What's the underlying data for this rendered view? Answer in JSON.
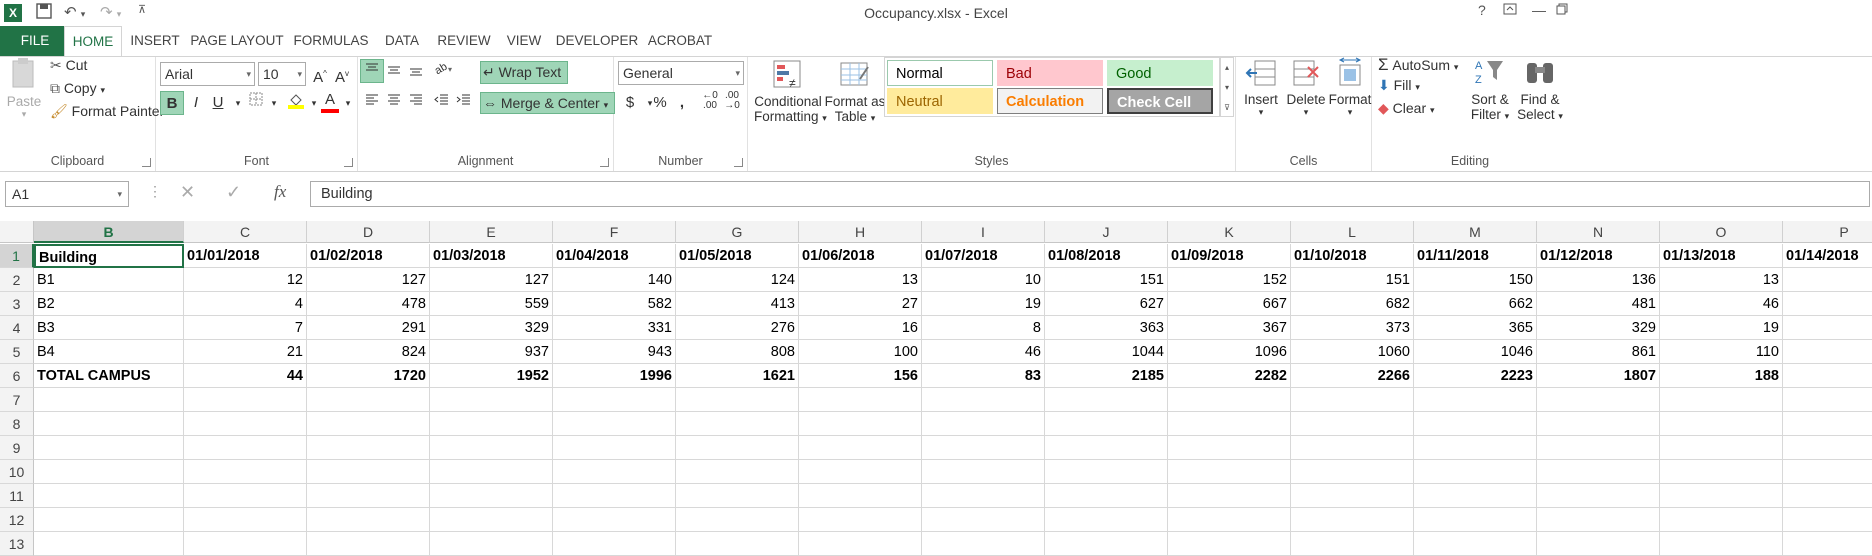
{
  "window": {
    "title": "Occupancy.xlsx - Excel",
    "help": "?"
  },
  "tabs": [
    "FILE",
    "HOME",
    "INSERT",
    "PAGE LAYOUT",
    "FORMULAS",
    "DATA",
    "REVIEW",
    "VIEW",
    "DEVELOPER",
    "ACROBAT"
  ],
  "clipboard": {
    "paste": "Paste",
    "cut": "Cut",
    "copy": "Copy",
    "format_painter": "Format Painter",
    "label": "Clipboard"
  },
  "font": {
    "name": "Arial",
    "size": "10",
    "label": "Font",
    "bold": "B",
    "italic": "I",
    "underline": "U"
  },
  "alignment": {
    "wrap": "Wrap Text",
    "merge": "Merge & Center",
    "label": "Alignment"
  },
  "number": {
    "format": "General",
    "label": "Number",
    "currency": "$",
    "percent": "%",
    "comma": ","
  },
  "styles": {
    "conditional": "Conditional",
    "conditional2": "Formatting",
    "format_as": "Format as",
    "format_as2": "Table",
    "label": "Styles",
    "items": [
      {
        "name": "Normal",
        "bg": "#ffffff",
        "fg": "#000000",
        "border": "#9bc9ad"
      },
      {
        "name": "Bad",
        "bg": "#ffc7ce",
        "fg": "#9c0006",
        "border": "#ffc7ce"
      },
      {
        "name": "Good",
        "bg": "#c6efce",
        "fg": "#006100",
        "border": "#c6efce"
      },
      {
        "name": "Neutral",
        "bg": "#ffeb9c",
        "fg": "#9c6500",
        "border": "#ffeb9c"
      },
      {
        "name": "Calculation",
        "bg": "#f2f2f2",
        "fg": "#fa7d00",
        "border": "#7f7f7f"
      },
      {
        "name": "Check Cell",
        "bg": "#a5a5a5",
        "fg": "#ffffff",
        "border": "#3f3f3f"
      }
    ]
  },
  "cells_group": {
    "insert": "Insert",
    "delete": "Delete",
    "format": "Format",
    "label": "Cells"
  },
  "editing": {
    "autosum": "AutoSum",
    "fill": "Fill",
    "clear": "Clear",
    "sort": "Sort &",
    "sort2": "Filter",
    "find": "Find &",
    "find2": "Select",
    "label": "Editing"
  },
  "formula_bar": {
    "name_box": "A1",
    "content": "Building",
    "fx": "fx"
  },
  "columns": [
    "B",
    "C",
    "D",
    "E",
    "F",
    "G",
    "H",
    "I",
    "J",
    "K",
    "L",
    "M",
    "N",
    "O",
    "P"
  ],
  "rows": [
    "1",
    "2",
    "3",
    "4",
    "5",
    "6",
    "7",
    "8",
    "9",
    "10",
    "11",
    "12",
    "13"
  ],
  "sheet": {
    "header": [
      "Building",
      "01/01/2018",
      "01/02/2018",
      "01/03/2018",
      "01/04/2018",
      "01/05/2018",
      "01/06/2018",
      "01/07/2018",
      "01/08/2018",
      "01/09/2018",
      "01/10/2018",
      "01/11/2018",
      "01/12/2018",
      "01/13/2018",
      "01/14/2018"
    ],
    "data": [
      [
        "B1",
        "12",
        "127",
        "127",
        "140",
        "124",
        "13",
        "10",
        "151",
        "152",
        "151",
        "150",
        "136",
        "13",
        ""
      ],
      [
        "B2",
        "4",
        "478",
        "559",
        "582",
        "413",
        "27",
        "19",
        "627",
        "667",
        "682",
        "662",
        "481",
        "46",
        ""
      ],
      [
        "B3",
        "7",
        "291",
        "329",
        "331",
        "276",
        "16",
        "8",
        "363",
        "367",
        "373",
        "365",
        "329",
        "19",
        ""
      ],
      [
        "B4",
        "21",
        "824",
        "937",
        "943",
        "808",
        "100",
        "46",
        "1044",
        "1096",
        "1060",
        "1046",
        "861",
        "110",
        ""
      ]
    ],
    "total": [
      " TOTAL CAMPUS",
      "44",
      "1720",
      "1952",
      "1996",
      "1621",
      "156",
      "83",
      "2185",
      "2282",
      "2266",
      "2223",
      "1807",
      "188",
      ""
    ]
  }
}
